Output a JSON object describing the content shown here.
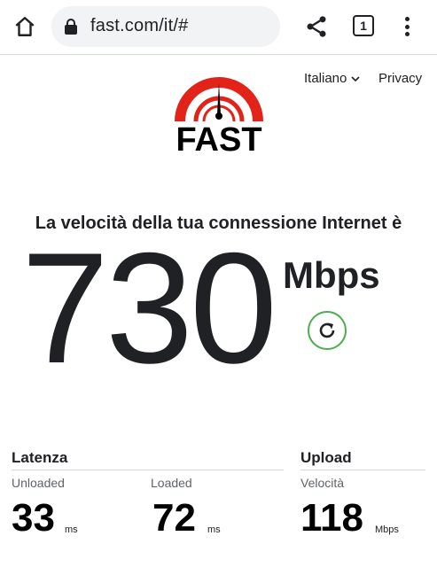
{
  "browser": {
    "url": "fast.com/it/#",
    "tab_count": "1",
    "icons": {
      "home": "home-icon",
      "lock": "lock-icon",
      "share": "share-icon",
      "menu": "more-vert-icon"
    }
  },
  "header": {
    "language_label": "Italiano",
    "privacy_label": "Privacy"
  },
  "logo": {
    "text": "FAST",
    "color": "#e2231a"
  },
  "result": {
    "headline": "La velocità della tua connessione Internet è",
    "speed": "730",
    "unit": "Mbps",
    "refresh_color": "#4cae4c"
  },
  "metrics": {
    "latency": {
      "title": "Latenza",
      "unloaded": {
        "label": "Unloaded",
        "value": "33",
        "unit": "ms"
      },
      "loaded": {
        "label": "Loaded",
        "value": "72",
        "unit": "ms"
      }
    },
    "upload": {
      "title": "Upload",
      "speed": {
        "label": "Velocità",
        "value": "118",
        "unit": "Mbps"
      }
    }
  }
}
